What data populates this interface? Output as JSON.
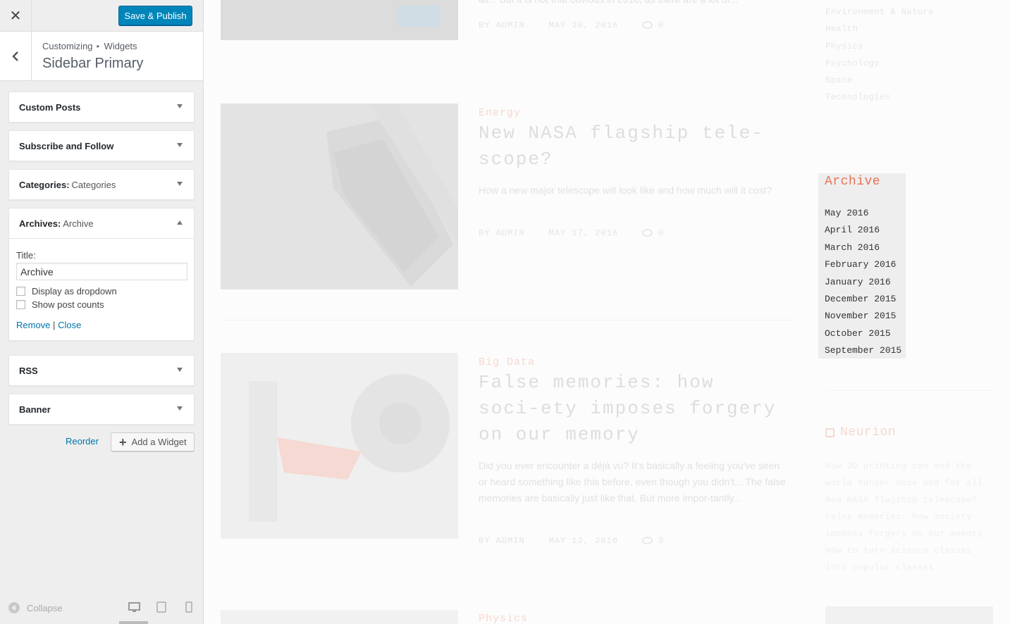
{
  "customizer": {
    "close_label": "✕",
    "publish_label": "Save & Publish",
    "breadcrumb": {
      "root": "Customizing",
      "separator": "▸",
      "section": "Widgets"
    },
    "section_title": "Sidebar Primary",
    "widgets": [
      {
        "title": "Custom Posts",
        "subtitle": ""
      },
      {
        "title": "Subscribe and Follow",
        "subtitle": ""
      },
      {
        "title": "Categories:",
        "subtitle": "Categories"
      },
      {
        "title": "Archives:",
        "subtitle": "Archive"
      },
      {
        "title": "RSS",
        "subtitle": ""
      },
      {
        "title": "Banner",
        "subtitle": ""
      }
    ],
    "archive_form": {
      "title_label": "Title:",
      "title_value": "Archive",
      "option_dropdown": "Display as dropdown",
      "option_counts": "Show post counts",
      "remove_label": "Remove",
      "separator": "|",
      "close_label": "Close"
    },
    "reorder_label": "Reorder",
    "add_widget_label": "Add a Widget",
    "collapse_label": "Collapse"
  },
  "preview": {
    "posts": [
      {
        "excerpt_tail": "all... But it is not that obvious in 2016, as there are a lot of...",
        "author": "BY ADMIN",
        "date": "MAY 20, 2016",
        "comments": "0"
      },
      {
        "category": "Energy",
        "title": "New NASA flagship tele-scope?",
        "excerpt": "How a new major telescope will look like and how much will it cost?",
        "author": "BY ADMIN",
        "date": "MAY 17, 2016",
        "comments": "0"
      },
      {
        "category": "Big Data",
        "title": "False memories: how soci-ety imposes forgery on our memory",
        "excerpt": "Did you ever encounter a déjà vu? It's basically a feeling you've seen or heard something like this before, even though you didn't... The false memories are basically just like that. But more impor-tantly...",
        "author": "BY ADMIN",
        "date": "MAY 12, 2016",
        "comments": "3"
      },
      {
        "category": "Physics"
      }
    ],
    "categories_tail": [
      "Environment & Nature",
      "Health",
      "Physics",
      "Psychology",
      "Space",
      "Technologies"
    ],
    "archive": {
      "title": "Archive",
      "items": [
        "May 2016",
        "April 2016",
        "March 2016",
        "February 2016",
        "January 2016",
        "December 2015",
        "November 2015",
        "October 2015",
        "September 2015"
      ]
    },
    "rss": {
      "title": "Neurion",
      "items_text": "How 3D printing can end the world hunger once and for all New NASA flagship telescope? False memories: how society imposes forgery on our memory How to turn science classes into popular classes"
    }
  },
  "colors": {
    "publish_blue": "#0085ba",
    "link_blue": "#0073aa",
    "archive_accent": "#e8735a"
  }
}
